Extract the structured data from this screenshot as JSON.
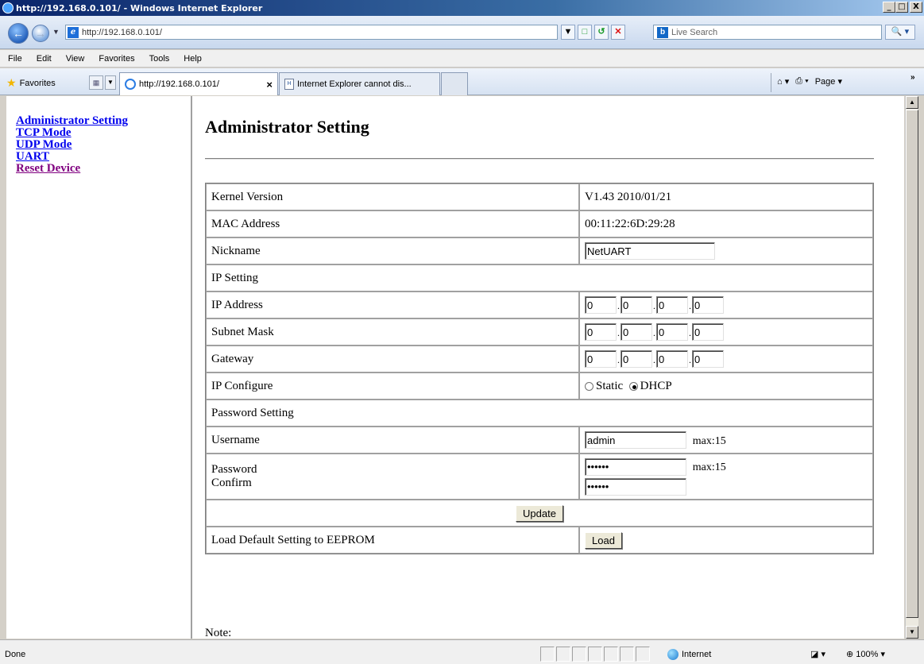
{
  "window": {
    "title": "http://192.168.0.101/ - Windows Internet Explorer",
    "buttons": [
      "_",
      "□",
      "X"
    ]
  },
  "address": {
    "url": "http://192.168.0.101/",
    "search_placeholder": "Live Search"
  },
  "menu": [
    "File",
    "Edit",
    "View",
    "Favorites",
    "Tools",
    "Help"
  ],
  "favorites": {
    "label": "Favorites",
    "tabs": [
      "http://192.168.0.101/",
      "Internet Explorer cannot dis..."
    ],
    "page_label": "Page"
  },
  "sidebar": {
    "links": [
      "Administrator Setting",
      "TCP Mode",
      "UDP Mode",
      "UART",
      "Reset Device"
    ]
  },
  "page": {
    "title": "Administrator Setting",
    "rows": {
      "kernel_label": "Kernel Version",
      "kernel_value": "V1.43 2010/01/21",
      "mac_label": "MAC Address",
      "mac_value": "00:11:22:6D:29:28",
      "nickname_label": "Nickname",
      "nickname_value": "NetUART",
      "ip_section": "IP Setting",
      "ip_label": "IP Address",
      "ip_values": [
        "0",
        "0",
        "0",
        "0"
      ],
      "mask_label": "Subnet Mask",
      "mask_values": [
        "0",
        "0",
        "0",
        "0"
      ],
      "gw_label": "Gateway",
      "gw_values": [
        "0",
        "0",
        "0",
        "0"
      ],
      "ipconf_label": "IP Configure",
      "ipconf_static": "Static",
      "ipconf_dhcp": "DHCP",
      "ipconf_selected": "DHCP",
      "pw_section": "Password Setting",
      "user_label": "Username",
      "user_value": "admin",
      "max_text": "max:15",
      "pw_label": "Password",
      "confirm_label": "Confirm",
      "pw_value": "••••••",
      "update_button": "Update",
      "load_label": "Load Default Setting to EEPROM",
      "load_button": "Load"
    },
    "note": "Note:"
  },
  "status": {
    "text": "Done",
    "zone": "Internet",
    "zoom": "100%"
  }
}
